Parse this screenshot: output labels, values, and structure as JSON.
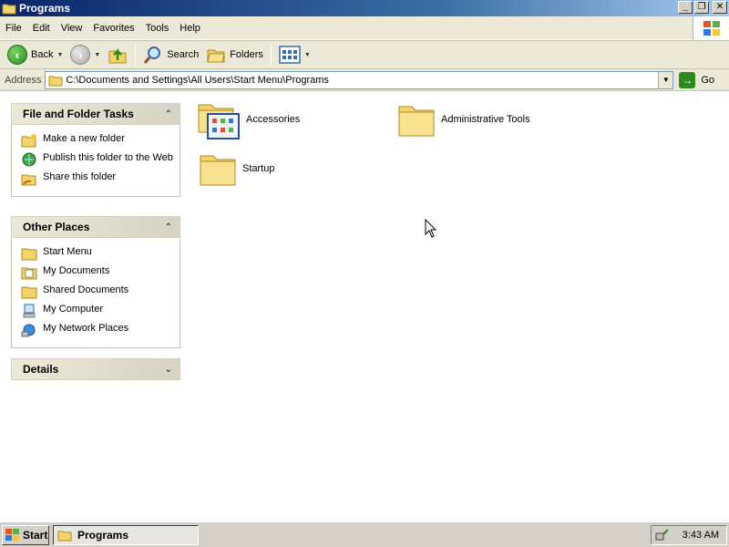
{
  "window": {
    "title": "Programs",
    "buttons": {
      "minimize": "_",
      "restore": "❐",
      "close": "✕"
    }
  },
  "menu": [
    "File",
    "Edit",
    "View",
    "Favorites",
    "Tools",
    "Help"
  ],
  "toolbar": {
    "back": "Back",
    "search": "Search",
    "folders": "Folders"
  },
  "address": {
    "label": "Address",
    "value": "C:\\Documents and Settings\\All Users\\Start Menu\\Programs",
    "go": "Go"
  },
  "panels": {
    "tasks": {
      "title": "File and Folder Tasks",
      "items": [
        {
          "label": "Make a new folder",
          "icon": "new-folder-icon"
        },
        {
          "label": "Publish this folder to the Web",
          "icon": "publish-web-icon"
        },
        {
          "label": "Share this folder",
          "icon": "share-folder-icon"
        }
      ]
    },
    "places": {
      "title": "Other Places",
      "items": [
        {
          "label": "Start Menu",
          "icon": "folder-icon"
        },
        {
          "label": "My Documents",
          "icon": "my-documents-icon"
        },
        {
          "label": "Shared Documents",
          "icon": "folder-icon"
        },
        {
          "label": "My Computer",
          "icon": "my-computer-icon"
        },
        {
          "label": "My Network Places",
          "icon": "network-places-icon"
        }
      ]
    },
    "details": {
      "title": "Details"
    }
  },
  "files": [
    {
      "name": "Accessories",
      "icon": "accessories-folder-icon"
    },
    {
      "name": "Administrative Tools",
      "icon": "folder-icon"
    },
    {
      "name": "Startup",
      "icon": "folder-icon"
    }
  ],
  "taskbar": {
    "start": "Start",
    "window_title": "Programs",
    "clock": "3:43 AM"
  },
  "colors": {
    "titlebar": "#0a246a",
    "chrome": "#ece9d8",
    "folder": "#f3d46b"
  }
}
